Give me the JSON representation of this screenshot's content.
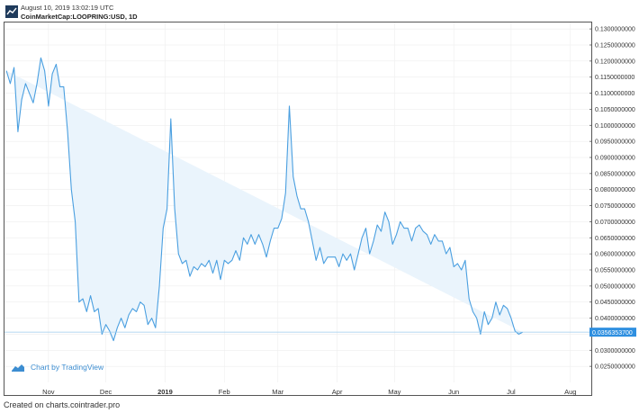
{
  "header": {
    "date": "August 10, 2019 13:02:19 UTC",
    "symbol": "CoinMarketCap:LOOPRING:USD, 1D"
  },
  "footer": {
    "text": "Created on charts.cointrader.pro"
  },
  "badge": {
    "text": "Chart by TradingView"
  },
  "colors": {
    "line": "#4a9fe0",
    "fill": "#eaf4fc",
    "last_price_bg": "#2e8fe0",
    "grid": "#eeeeee"
  },
  "chart_data": {
    "type": "area",
    "ylim": [
      0.02,
      0.132
    ],
    "yticks": [
      "0.1300000000",
      "0.1250000000",
      "0.1200000000",
      "0.1150000000",
      "0.1100000000",
      "0.1050000000",
      "0.1000000000",
      "0.0950000000",
      "0.0900000000",
      "0.0850000000",
      "0.0800000000",
      "0.0750000000",
      "0.0700000000",
      "0.0650000000",
      "0.0600000000",
      "0.0550000000",
      "0.0500000000",
      "0.0450000000",
      "0.0400000000",
      "0.0350000000",
      "0.0300000000",
      "0.0250000000"
    ],
    "xticks": [
      "Nov",
      "Dec",
      "2019",
      "Feb",
      "Mar",
      "Apr",
      "May",
      "Jun",
      "Jul",
      "Aug"
    ],
    "last_price": "0.0356353700",
    "x": [
      "2018-10-10",
      "2018-10-12",
      "2018-10-14",
      "2018-10-16",
      "2018-10-18",
      "2018-10-20",
      "2018-10-22",
      "2018-10-24",
      "2018-10-26",
      "2018-10-28",
      "2018-10-30",
      "2018-11-01",
      "2018-11-03",
      "2018-11-05",
      "2018-11-07",
      "2018-11-09",
      "2018-11-11",
      "2018-11-13",
      "2018-11-15",
      "2018-11-17",
      "2018-11-19",
      "2018-11-21",
      "2018-11-23",
      "2018-11-25",
      "2018-11-27",
      "2018-11-29",
      "2018-12-01",
      "2018-12-03",
      "2018-12-05",
      "2018-12-07",
      "2018-12-09",
      "2018-12-11",
      "2018-12-13",
      "2018-12-15",
      "2018-12-17",
      "2018-12-19",
      "2018-12-21",
      "2018-12-23",
      "2018-12-25",
      "2018-12-27",
      "2018-12-29",
      "2018-12-31",
      "2019-01-02",
      "2019-01-04",
      "2019-01-06",
      "2019-01-08",
      "2019-01-10",
      "2019-01-12",
      "2019-01-14",
      "2019-01-16",
      "2019-01-18",
      "2019-01-20",
      "2019-01-22",
      "2019-01-24",
      "2019-01-26",
      "2019-01-28",
      "2019-01-30",
      "2019-02-01",
      "2019-02-03",
      "2019-02-05",
      "2019-02-07",
      "2019-02-09",
      "2019-02-11",
      "2019-02-13",
      "2019-02-15",
      "2019-02-17",
      "2019-02-19",
      "2019-02-21",
      "2019-02-23",
      "2019-02-25",
      "2019-02-27",
      "2019-03-01",
      "2019-03-03",
      "2019-03-05",
      "2019-03-07",
      "2019-03-09",
      "2019-03-11",
      "2019-03-13",
      "2019-03-15",
      "2019-03-17",
      "2019-03-19",
      "2019-03-21",
      "2019-03-23",
      "2019-03-25",
      "2019-03-27",
      "2019-03-29",
      "2019-03-31",
      "2019-04-02",
      "2019-04-04",
      "2019-04-06",
      "2019-04-08",
      "2019-04-10",
      "2019-04-12",
      "2019-04-14",
      "2019-04-16",
      "2019-04-18",
      "2019-04-20",
      "2019-04-22",
      "2019-04-24",
      "2019-04-26",
      "2019-04-28",
      "2019-04-30",
      "2019-05-02",
      "2019-05-04",
      "2019-05-06",
      "2019-05-08",
      "2019-05-10",
      "2019-05-12",
      "2019-05-14",
      "2019-05-16",
      "2019-05-18",
      "2019-05-20",
      "2019-05-22",
      "2019-05-24",
      "2019-05-26",
      "2019-05-28",
      "2019-05-30",
      "2019-06-01",
      "2019-06-03",
      "2019-06-05",
      "2019-06-07",
      "2019-06-09",
      "2019-06-11",
      "2019-06-13",
      "2019-06-15",
      "2019-06-17",
      "2019-06-19",
      "2019-06-21",
      "2019-06-23",
      "2019-06-25",
      "2019-06-27",
      "2019-06-29",
      "2019-07-01",
      "2019-07-03",
      "2019-07-05",
      "2019-07-07",
      "2019-07-09",
      "2019-07-11",
      "2019-07-13",
      "2019-07-15",
      "2019-07-17",
      "2019-07-19",
      "2019-07-21",
      "2019-07-23",
      "2019-07-25",
      "2019-07-27",
      "2019-07-29",
      "2019-07-31",
      "2019-08-02",
      "2019-08-04",
      "2019-08-06",
      "2019-08-08",
      "2019-08-10"
    ],
    "values": [
      0.117,
      0.113,
      0.118,
      0.098,
      0.108,
      0.113,
      0.11,
      0.107,
      0.113,
      0.121,
      0.117,
      0.106,
      0.116,
      0.119,
      0.112,
      0.112,
      0.098,
      0.08,
      0.07,
      0.045,
      0.046,
      0.042,
      0.047,
      0.042,
      0.043,
      0.035,
      0.038,
      0.036,
      0.033,
      0.037,
      0.04,
      0.037,
      0.041,
      0.043,
      0.042,
      0.045,
      0.044,
      0.038,
      0.04,
      0.037,
      0.05,
      0.068,
      0.074,
      0.102,
      0.074,
      0.06,
      0.057,
      0.058,
      0.053,
      0.056,
      0.055,
      0.057,
      0.056,
      0.058,
      0.054,
      0.058,
      0.052,
      0.058,
      0.057,
      0.058,
      0.061,
      0.058,
      0.065,
      0.063,
      0.066,
      0.063,
      0.066,
      0.063,
      0.059,
      0.064,
      0.068,
      0.068,
      0.071,
      0.079,
      0.106,
      0.084,
      0.078,
      0.074,
      0.074,
      0.07,
      0.064,
      0.058,
      0.062,
      0.057,
      0.059,
      0.059,
      0.059,
      0.056,
      0.06,
      0.058,
      0.06,
      0.055,
      0.06,
      0.065,
      0.068,
      0.06,
      0.064,
      0.069,
      0.067,
      0.073,
      0.07,
      0.063,
      0.066,
      0.07,
      0.068,
      0.068,
      0.064,
      0.068,
      0.069,
      0.067,
      0.066,
      0.063,
      0.066,
      0.064,
      0.064,
      0.06,
      0.062,
      0.056,
      0.057,
      0.055,
      0.058,
      0.046,
      0.042,
      0.04,
      0.035,
      0.042,
      0.038,
      0.04,
      0.045,
      0.041,
      0.044,
      0.043,
      0.04,
      0.036,
      0.035,
      0.0356
    ]
  }
}
